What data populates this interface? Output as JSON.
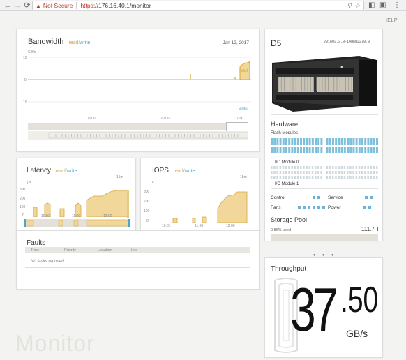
{
  "browser": {
    "nav": {
      "back": "←",
      "forward": "→",
      "reload": "⟳"
    },
    "security_label": "Not Secure",
    "url_scheme": "https",
    "url_rest": "://176.16.40.1/monitor"
  },
  "header": {
    "help": "HELP"
  },
  "page_watermark": "Monitor",
  "bandwidth": {
    "title": "Bandwidth",
    "read": "read",
    "slash": "/",
    "write": "write",
    "date": "Jan 12, 2017",
    "unit": "GB/s",
    "ytick_top": "10",
    "ytick_mid": "0",
    "ytick_bottom": "10",
    "series_read_label": "read",
    "series_write_label": "write",
    "xticks": [
      "00:00",
      "20:00",
      "11:00"
    ]
  },
  "latency": {
    "title": "Latency",
    "read": "read",
    "slash": "/",
    "write": "write",
    "unit": "μs",
    "range": "15m",
    "yticks": [
      "300",
      "200",
      "100",
      "0"
    ],
    "xticks": [
      "10:01",
      "11:00",
      "12:00"
    ]
  },
  "iops": {
    "title": "IOPS",
    "read": "read",
    "slash": "/",
    "write": "write",
    "unit": "K",
    "range": "15m",
    "yticks": [
      "300",
      "200",
      "100",
      "0"
    ],
    "xticks": [
      "10:01",
      "11:00",
      "12:00"
    ]
  },
  "faults": {
    "title": "Faults",
    "columns": [
      "Time",
      "Priority",
      "Location",
      "Info"
    ],
    "empty": "No faults reported."
  },
  "array": {
    "name": "D5",
    "version": "201603.3.3-14d6d2279.8",
    "hardware_title": "Hardware",
    "flash_label": "Flash Modules",
    "io0": "I/O Module 0",
    "io1": "I/O Module 1",
    "control": "Control",
    "fans": "Fans",
    "service": "Service",
    "power": "Power",
    "storage_title": "Storage Pool",
    "used": "0.86% used",
    "capacity": "111.7 T",
    "used_pct": 0.86
  },
  "throughput": {
    "title": "Throughput",
    "value_int": "37",
    "value_dec": ".50",
    "unit": "GB/s"
  },
  "colors": {
    "read": "#d6a640",
    "write": "#4aa6cf",
    "status_ok": "#6cb4d6"
  }
}
